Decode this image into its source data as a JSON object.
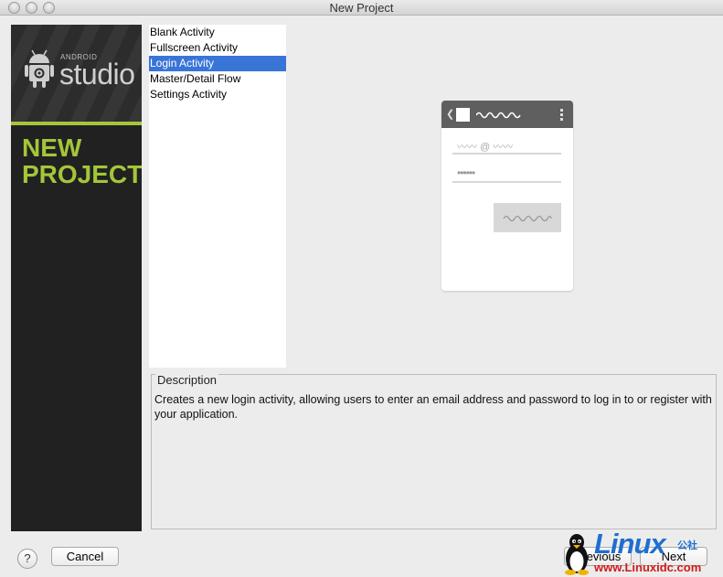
{
  "window": {
    "title": "New Project"
  },
  "sidebar": {
    "brand_small": "ANDROID",
    "brand_big": "studio",
    "heading_line1": "NEW",
    "heading_line2": "PROJECT"
  },
  "templates": {
    "items": [
      {
        "label": "Blank Activity",
        "selected": false
      },
      {
        "label": "Fullscreen Activity",
        "selected": false
      },
      {
        "label": "Login Activity",
        "selected": true
      },
      {
        "label": "Master/Detail Flow",
        "selected": false
      },
      {
        "label": "Settings Activity",
        "selected": false
      }
    ]
  },
  "preview": {
    "email_hint": "〰〰 @ 〰〰",
    "password_hint": "••••••"
  },
  "description": {
    "legend": "Description",
    "text": "Creates a new login activity, allowing users to enter an email address and password to log in to or register with your application."
  },
  "footer": {
    "help_label": "?",
    "cancel_label": "Cancel",
    "previous_label": "Previous",
    "next_label": "Next"
  },
  "watermark": {
    "brand": "Linux",
    "badge": "公社",
    "url": "www.Linuxidc.com"
  },
  "colors": {
    "accent_green": "#a4c639",
    "selection_blue": "#3875d7",
    "sidebar_bg": "#212121"
  }
}
